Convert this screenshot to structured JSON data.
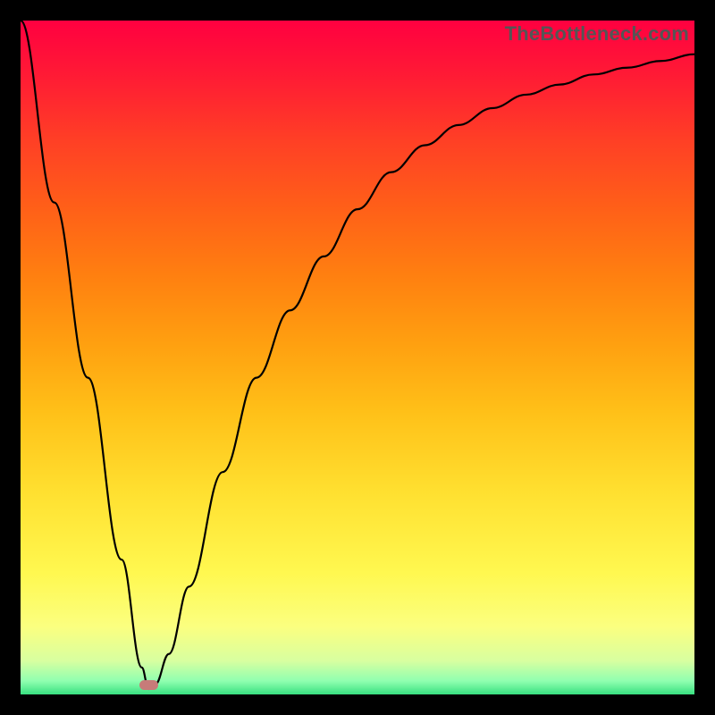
{
  "watermark": "TheBottleneck.com",
  "colors": {
    "frame": "#000000",
    "gradient_top": "#ff0040",
    "gradient_bottom": "#38e080",
    "curve": "#000000",
    "marker": "#c77b79"
  },
  "chart_data": {
    "type": "line",
    "title": "",
    "xlabel": "",
    "ylabel": "",
    "xlim": [
      0,
      100
    ],
    "ylim": [
      0,
      100
    ],
    "marker": {
      "x": 19,
      "y": 1.5
    },
    "series": [
      {
        "name": "curve",
        "x": [
          0,
          5,
          10,
          15,
          18,
          19,
          20,
          22,
          25,
          30,
          35,
          40,
          45,
          50,
          55,
          60,
          65,
          70,
          75,
          80,
          85,
          90,
          95,
          100
        ],
        "y": [
          100,
          73,
          47,
          20,
          4,
          0.8,
          1.5,
          6,
          16,
          33,
          47,
          57,
          65,
          72,
          77.5,
          81.5,
          84.5,
          87,
          89,
          90.5,
          92,
          93,
          94,
          95
        ]
      }
    ],
    "grid": false,
    "legend": false
  }
}
